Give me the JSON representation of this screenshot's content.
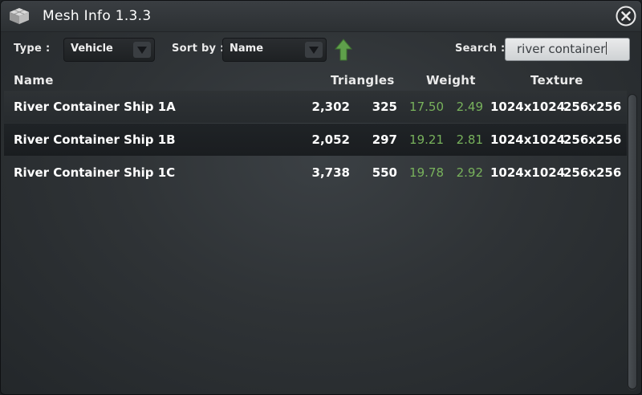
{
  "window": {
    "title": "Mesh Info 1.3.3"
  },
  "toolbar": {
    "type_label": "Type :",
    "type_value": "Vehicle",
    "sort_label": "Sort by :",
    "sort_value": "Name",
    "sort_direction": "ascending",
    "search_label": "Search :",
    "search_value": "river container"
  },
  "columns": [
    "Name",
    "Triangles",
    "Weight",
    "Texture"
  ],
  "rows": [
    {
      "name": "River Container Ship 1A",
      "triangles": "2,302",
      "lod_triangles": "325",
      "weight": "17.50",
      "lod_weight": "2.49",
      "texture": "1024x1024",
      "lod_texture": "256x256"
    },
    {
      "name": "River Container Ship 1B",
      "triangles": "2,052",
      "lod_triangles": "297",
      "weight": "19.21",
      "lod_weight": "2.81",
      "texture": "1024x1024",
      "lod_texture": "256x256"
    },
    {
      "name": "River Container Ship 1C",
      "triangles": "3,738",
      "lod_triangles": "550",
      "weight": "19.78",
      "lod_weight": "2.92",
      "texture": "1024x1024",
      "lod_texture": "256x256"
    }
  ],
  "colors": {
    "accent_green": "#78b25c",
    "sort_arrow_green": "#5fa04b",
    "background": "#2f3336"
  },
  "icons": {
    "app": "mesh-cube-icon",
    "close": "close-icon",
    "dropdown": "chevron-down-icon",
    "sort": "arrow-up-icon"
  }
}
